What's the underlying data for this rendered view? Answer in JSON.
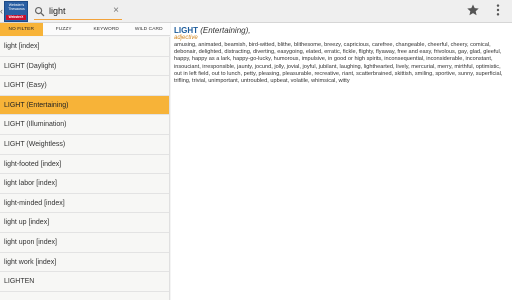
{
  "header": {
    "logo_text": "Webster's Thesaurus",
    "logo_tag": "WebsterX",
    "search_value": "light"
  },
  "icons": {
    "back": "chevron-left-icon",
    "search": "search-icon",
    "clear": "close-icon",
    "favorite": "star-icon",
    "menu": "more-vert-icon"
  },
  "colors": {
    "accent": "#f7b338",
    "headword": "#1e5d9c",
    "pos": "#d2861f"
  },
  "filters": [
    {
      "label": "NO FILTER",
      "active": true
    },
    {
      "label": "FUZZY",
      "active": false
    },
    {
      "label": "KEYWORD",
      "active": false
    },
    {
      "label": "WILD CARD",
      "active": false
    }
  ],
  "results": [
    {
      "label": "light [index]"
    },
    {
      "label": "LIGHT (Daylight)"
    },
    {
      "label": "LIGHT (Easy)"
    },
    {
      "label": "LIGHT (Entertaining)",
      "selected": true
    },
    {
      "label": "LIGHT (Illumination)"
    },
    {
      "label": "LIGHT (Weightless)"
    },
    {
      "label": "light-footed [index]"
    },
    {
      "label": "light labor [index]"
    },
    {
      "label": "light-minded [index]"
    },
    {
      "label": "light up [index]"
    },
    {
      "label": "light upon [index]"
    },
    {
      "label": "light work [index]"
    },
    {
      "label": "LIGHTEN"
    }
  ],
  "entry": {
    "headword": "LIGHT",
    "sense": "(Entertaining),",
    "pos": "adjective",
    "synonyms": "amusing, animated, beamish, bird-witted, blithe, blithesome, breezy, capricious, carefree, changeable, cheerful, cheery, comical, debonair, delighted, distracting, diverting, easygoing, elated, erratic, fickle, flighty, flyaway, free and easy, frivolous, gay, glad, gleeful, happy, happy as a lark, happy-go-lucky, humorous, impulsive, in good or high spirits, inconsequential, inconsiderable, inconstant, insouciant, irresponsible, jaunty, jocund, jolly, jovial, joyful, jubilant, laughing, lighthearted, lively, mercurial, merry, mirthful, optimistic, out in left field, out to lunch, petty, pleasing, pleasurable, recreative, riant, scatterbrained, skittish, smiling, sportive, sunny, superficial, trifling, trivial, unimportant, untroubled, upbeat, volatile, whimsical, witty"
  }
}
